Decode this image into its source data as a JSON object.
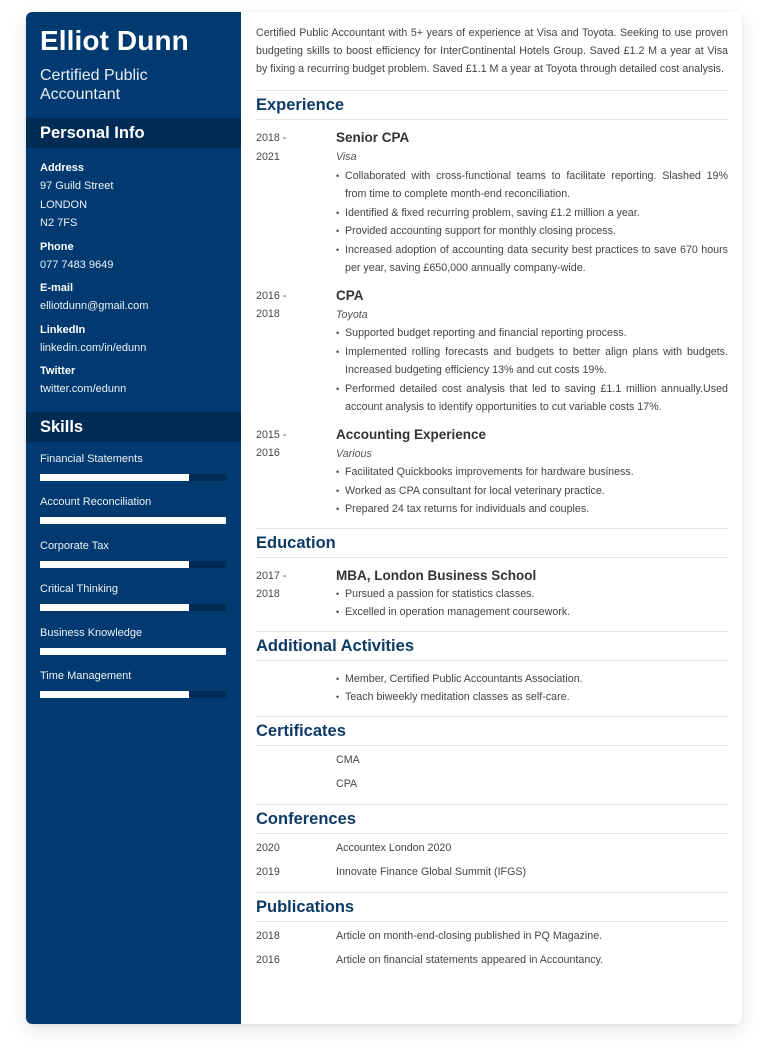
{
  "header": {
    "name": "Elliot Dunn",
    "title": "Certified Public Accountant"
  },
  "colors": {
    "sidebar_bg": "#003a70",
    "sidebar_section_bg": "#002b55",
    "heading": "#0d3b66"
  },
  "personal_info": {
    "title": "Personal Info",
    "address_label": "Address",
    "address_lines": [
      "97 Guild Street",
      "LONDON",
      "N2 7FS"
    ],
    "phone_label": "Phone",
    "phone": "077 7483 9649",
    "email_label": "E-mail",
    "email": "elliotdunn@gmail.com",
    "linkedin_label": "LinkedIn",
    "linkedin": "linkedin.com/in/edunn",
    "twitter_label": "Twitter",
    "twitter": "twitter.com/edunn"
  },
  "skills": {
    "title": "Skills",
    "items": [
      {
        "label": "Financial Statements",
        "level": 0.8
      },
      {
        "label": "Account Reconciliation",
        "level": 1.0
      },
      {
        "label": "Corporate Tax",
        "level": 0.8
      },
      {
        "label": "Critical Thinking",
        "level": 0.8
      },
      {
        "label": "Business Knowledge",
        "level": 1.0
      },
      {
        "label": "Time Management",
        "level": 0.8
      }
    ]
  },
  "summary": "Certified Public Accountant with 5+ years of experience at Visa and Toyota. Seeking to use proven budgeting skills to boost efficiency for InterContinental Hotels Group. Saved £1.2 M a year at Visa by fixing a recurring budget problem. Saved £1.1 M a year at Toyota through detailed cost analysis.",
  "experience": {
    "title": "Experience",
    "items": [
      {
        "date_start": "2018 -",
        "date_end": "2021",
        "role": "Senior CPA",
        "org": "Visa",
        "bullets": [
          "Collaborated with cross-functional teams to facilitate reporting. Slashed 19% from time to complete month-end reconciliation.",
          "Identified & fixed recurring problem, saving £1.2 million a year.",
          "Provided accounting support for monthly closing process.",
          "Increased adoption of accounting data security best practices to save 670 hours per year, saving £650,000 annually company-wide."
        ]
      },
      {
        "date_start": "2016 -",
        "date_end": "2018",
        "role": "CPA",
        "org": "Toyota",
        "bullets": [
          "Supported budget reporting and financial reporting process.",
          "Implemented rolling forecasts and budgets to better align plans with budgets. Increased budgeting efficiency 13% and cut costs 19%.",
          "Performed detailed cost analysis that led to saving £1.1 million annually.Used account analysis to identify opportunities to cut variable costs 17%."
        ]
      },
      {
        "date_start": "2015 -",
        "date_end": "2016",
        "role": "Accounting Experience",
        "org": "Various",
        "bullets": [
          "Facilitated Quickbooks improvements for hardware business.",
          "Worked as CPA consultant for local veterinary practice.",
          "Prepared 24 tax returns for individuals and couples."
        ]
      }
    ]
  },
  "education": {
    "title": "Education",
    "items": [
      {
        "date_start": "2017 -",
        "date_end": "2018",
        "degree": "MBA, London Business School",
        "bullets": [
          "Pursued a passion for statistics classes.",
          "Excelled in operation management coursework."
        ]
      }
    ]
  },
  "activities": {
    "title": "Additional Activities",
    "bullets": [
      "Member, Certified Public Accountants Association.",
      "Teach biweekly meditation classes as self-care."
    ]
  },
  "certificates": {
    "title": "Certificates",
    "items": [
      "CMA",
      "CPA"
    ]
  },
  "conferences": {
    "title": "Conferences",
    "items": [
      {
        "year": "2020",
        "name": "Accountex London 2020"
      },
      {
        "year": "2019",
        "name": "Innovate Finance Global Summit (IFGS)"
      }
    ]
  },
  "publications": {
    "title": "Publications",
    "items": [
      {
        "year": "2018",
        "name": "Article on month-end-closing published in PQ Magazine."
      },
      {
        "year": "2016",
        "name": "Article on financial statements appeared in Accountancy."
      }
    ]
  }
}
